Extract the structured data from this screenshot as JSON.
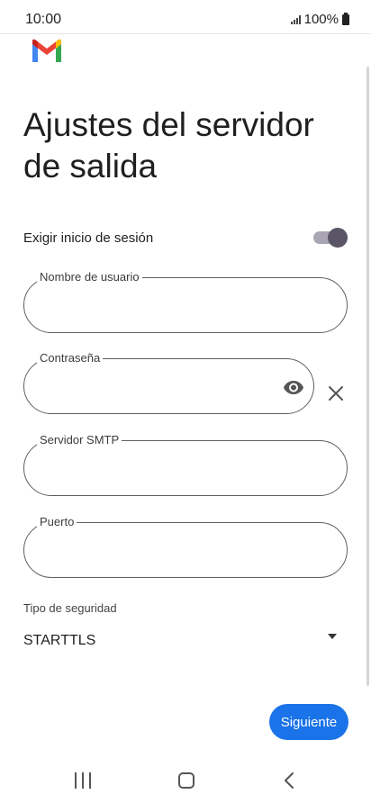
{
  "status_bar": {
    "time": "10:00",
    "battery_text": "100%"
  },
  "app": {
    "logo_icon": "gmail-icon"
  },
  "page": {
    "title": "Ajustes del servidor de salida"
  },
  "require_signin": {
    "label": "Exigir inicio de sesión",
    "enabled": true
  },
  "fields": {
    "username": {
      "label": "Nombre de usuario",
      "value": ""
    },
    "password": {
      "label": "Contraseña",
      "value": ""
    },
    "smtp_server": {
      "label": "Servidor SMTP",
      "value": ""
    },
    "port": {
      "label": "Puerto",
      "value": ""
    }
  },
  "security": {
    "label": "Tipo de seguridad",
    "value": "STARTTLS"
  },
  "actions": {
    "next_label": "Siguiente"
  },
  "colors": {
    "primary": "#1a73e8",
    "toggle_thumb": "#5b5568",
    "toggle_track": "#a9a5b3"
  }
}
